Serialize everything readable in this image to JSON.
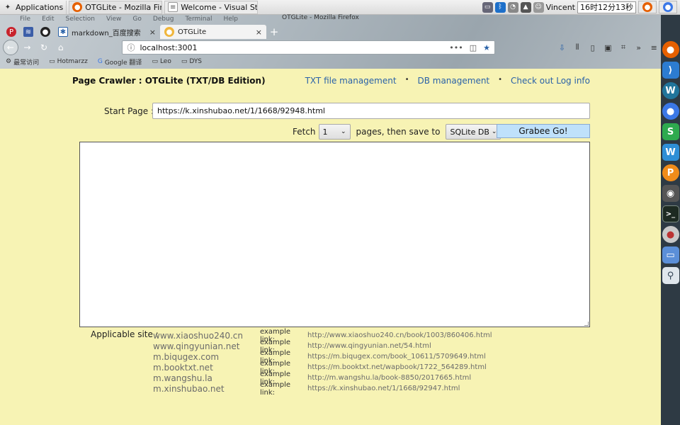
{
  "os_taskbar": {
    "applications_label": "Applications",
    "windows": [
      {
        "title": "OTGLite - Mozilla Firefox",
        "active": true
      },
      {
        "title": "Welcome - Visual Studio...",
        "active": false
      }
    ],
    "user": "Vincent",
    "clock": "16时12分13秒"
  },
  "browser": {
    "menu": [
      "File",
      "Edit",
      "Selection",
      "View",
      "Go",
      "Debug",
      "Terminal",
      "Help"
    ],
    "window_title": "OTGLite - Mozilla Firefox",
    "tabs": [
      {
        "title": "markdown_百度搜索",
        "close": "×"
      },
      {
        "title": "OTGLite",
        "close": "×"
      }
    ],
    "new_tab": "+",
    "url": "localhost:3001",
    "bookmarks": [
      "最常访问",
      "Hotmarzz",
      "Google 翻译",
      "Leo",
      "DYS"
    ]
  },
  "app": {
    "title": "Page Crawler : OTGLite (TXT/DB Edition)",
    "nav": {
      "txt": "TXT file management",
      "db": "DB management",
      "log": "Check out Log info",
      "separator": "•"
    },
    "start_label": "Start Page :",
    "start_url": "https://k.xinshubao.net/1/1668/92948.html",
    "fetch_label": "Fetch",
    "pages_value": "1",
    "pages_then": "pages, then save to",
    "save_target": "SQLite DB",
    "go_button": "Grabee Go!",
    "log_text": "",
    "sites_label": "Applicable site :",
    "example_label": "example link:",
    "sites": [
      {
        "name": "www.xiaoshuo240.cn",
        "example": "http://www.xiaoshuo240.cn/book/1003/860406.html"
      },
      {
        "name": "www.qingyunian.net",
        "example": "http://www.qingyunian.net/54.html"
      },
      {
        "name": "m.biqugex.com",
        "example": "https://m.biqugex.com/book_10611/5709649.html"
      },
      {
        "name": "m.booktxt.net",
        "example": "https://m.booktxt.net/wapbook/1722_564289.html"
      },
      {
        "name": "m.wangshu.la",
        "example": "http://m.wangshu.la/book-8850/2017665.html"
      },
      {
        "name": "m.xinshubao.net",
        "example": "https://k.xinshubao.net/1/1668/92947.html"
      }
    ]
  },
  "colors": {
    "page_bg": "#f7f3b4",
    "link": "#2a62a8",
    "go_button": "#bfe1fb"
  }
}
